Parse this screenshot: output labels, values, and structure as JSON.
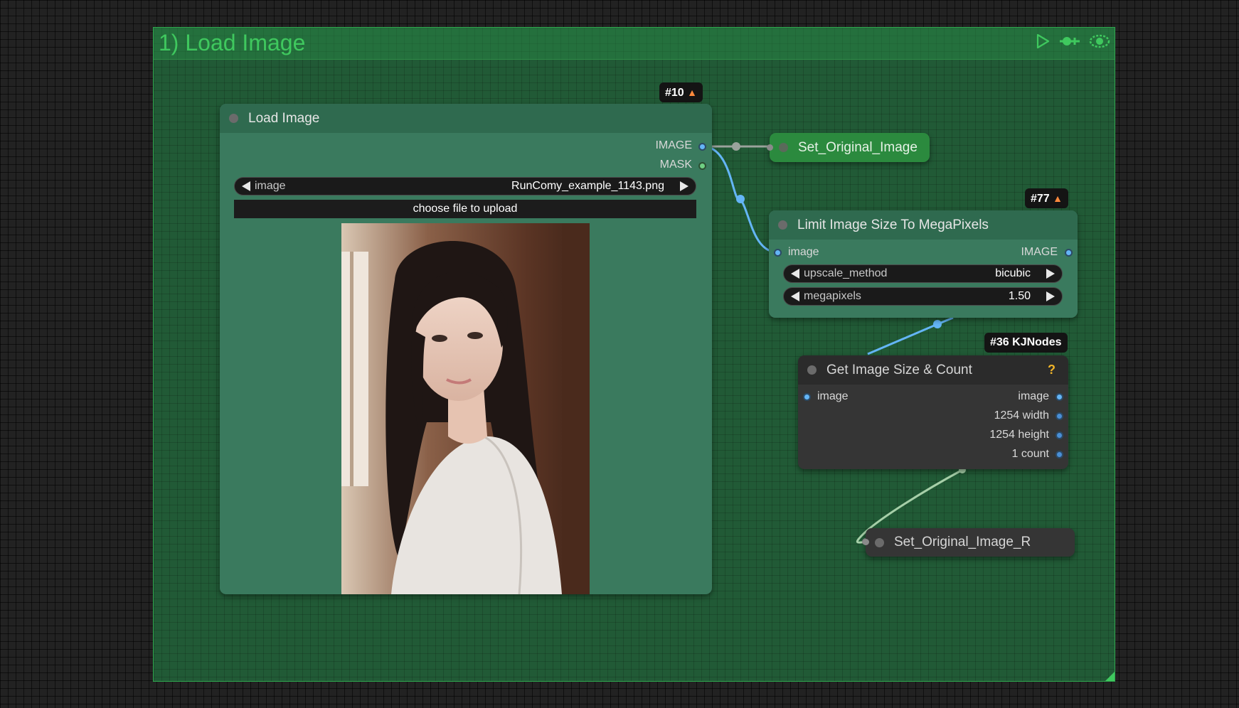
{
  "group": {
    "title": "1) Load Image",
    "color": "#215a36",
    "accent": "#3fc85e",
    "action_icons": [
      "play-icon",
      "pin-icon",
      "eye-icon"
    ]
  },
  "load_image_node": {
    "badge": "#10",
    "badge_icon": "fox-icon",
    "title": "Load Image",
    "outputs": [
      "IMAGE",
      "MASK"
    ],
    "image_widget": {
      "name": "image",
      "value": "RunComy_example_1143.png"
    },
    "upload_label": "choose file to upload",
    "preview_icon": "portrait-photo"
  },
  "set_original_node": {
    "title": "Set_Original_Image"
  },
  "limit_node": {
    "badge": "#77",
    "badge_icon": "fox-icon",
    "title": "Limit Image Size To MegaPixels",
    "input": "image",
    "output": "IMAGE",
    "widgets": [
      {
        "name": "upscale_method",
        "value": "bicubic"
      },
      {
        "name": "megapixels",
        "value": "1.50"
      }
    ]
  },
  "size_node": {
    "badge": "#36 KJNodes",
    "title": "Get Image Size & Count",
    "help": "?",
    "input": "image",
    "outputs": [
      "image",
      "1254 width",
      "1254 height",
      "1 count"
    ]
  },
  "set_original_r_node": {
    "title": "Set_Original_Image_R"
  },
  "colors": {
    "canvas": "#222222",
    "node_body": "#353535",
    "load_node_body": "#3a7a5e",
    "set_node": "#2b8a3e",
    "link_blue": "#64b5f6",
    "link_grey": "#9aa39c",
    "link_green": "#a6cfa8"
  }
}
